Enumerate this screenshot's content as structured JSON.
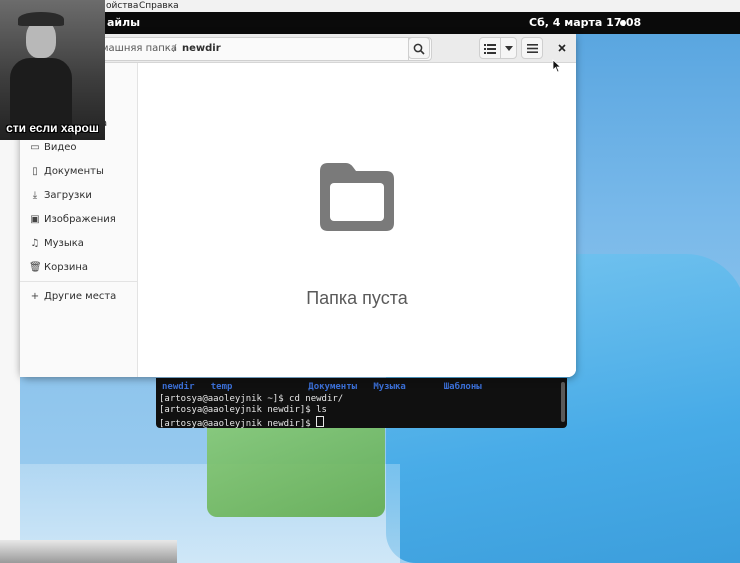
{
  "menu_strip": {
    "items": [
      "ойства",
      "Справка"
    ]
  },
  "topbar": {
    "app_name": "айлы",
    "clock": "Сб, 4 марта  17:08"
  },
  "file_manager": {
    "path": {
      "home": "машняя папка",
      "separator": "/",
      "current": "newdir"
    },
    "sidebar": {
      "items": [
        {
          "label": "ка",
          "icon": "desktop-icon"
        },
        {
          "label": "Видео",
          "icon": "video-icon"
        },
        {
          "label": "Документы",
          "icon": "document-icon"
        },
        {
          "label": "Загрузки",
          "icon": "download-icon"
        },
        {
          "label": "Изображения",
          "icon": "image-icon"
        },
        {
          "label": "Музыка",
          "icon": "music-icon"
        },
        {
          "label": "Корзина",
          "icon": "trash-icon"
        },
        {
          "label": "Другие места",
          "icon": "plus-icon"
        }
      ]
    },
    "empty_message": "Папка пуста"
  },
  "terminal": {
    "ls_header": "newdir   temp              Документы   Музыка       Шаблоны",
    "lines": [
      "[artosya@aaoleyjnik ~]$ cd newdir/",
      "[artosya@aaoleyjnik newdir]$ ls",
      "[artosya@aaoleyjnik newdir]$ "
    ]
  },
  "webcam": {
    "caption": "сти если харош"
  },
  "colors": {
    "topbar": "#0a0a0a",
    "desktop_blue": "#79b9ea",
    "terminal_bg": "#101010",
    "folder_gray": "#7a7a7a"
  }
}
